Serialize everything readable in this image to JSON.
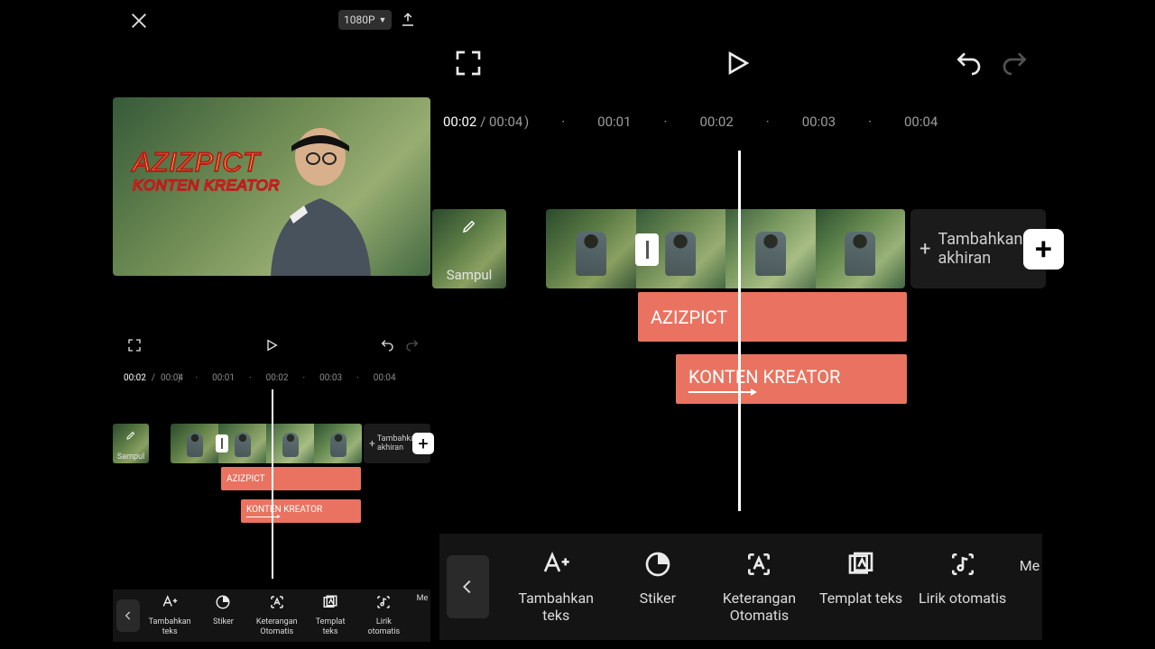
{
  "header": {
    "resolution_label": "1080P"
  },
  "playback": {
    "current": "00:02",
    "total": "00:04"
  },
  "ruler_ticks": [
    "00:01",
    "00:02",
    "00:03",
    "00:04"
  ],
  "cover_tile_label": "Sampul",
  "add_ending_label": "Tambahkan akhiran",
  "text_tracks": {
    "t1": "AZIZPICT",
    "t2": "KONTEN KREATOR"
  },
  "preview_titles": {
    "main": "AZIZPICT",
    "sub": "KONTEN KREATOR"
  },
  "toolbar": {
    "items": [
      {
        "id": "add-text",
        "label": "Tambahkan teks"
      },
      {
        "id": "sticker",
        "label": "Stiker"
      },
      {
        "id": "auto-caption",
        "label": "Keterangan Otomatis"
      },
      {
        "id": "text-template",
        "label": "Templat teks"
      },
      {
        "id": "auto-lyrics",
        "label": "Lirik otomatis"
      },
      {
        "id": "more",
        "label": "Me"
      }
    ]
  }
}
